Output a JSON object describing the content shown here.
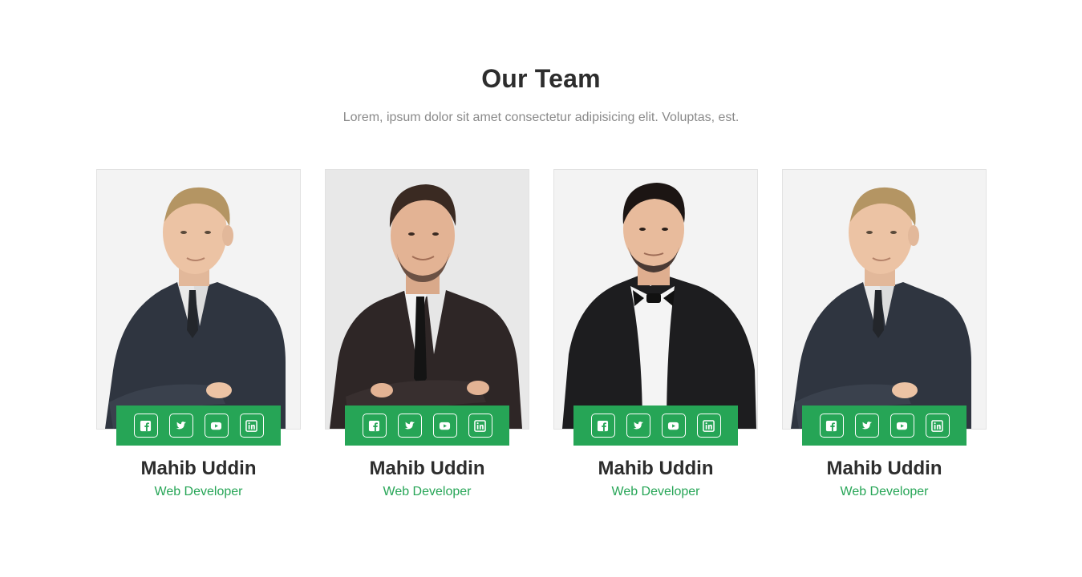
{
  "section": {
    "title": "Our Team",
    "subtitle": "Lorem, ipsum dolor sit amet consectetur adipisicing elit. Voluptas, est."
  },
  "colors": {
    "accent": "#26a556",
    "heading": "#2d2d2d",
    "muted": "#8a8a8a"
  },
  "members": [
    {
      "name": "Mahib Uddin",
      "role": "Web Developer",
      "photo": "man-blond-dark-suit"
    },
    {
      "name": "Mahib Uddin",
      "role": "Web Developer",
      "photo": "man-brown-hair-suit"
    },
    {
      "name": "Mahib Uddin",
      "role": "Web Developer",
      "photo": "man-black-hair-bowtie"
    },
    {
      "name": "Mahib Uddin",
      "role": "Web Developer",
      "photo": "man-blond-dark-suit"
    }
  ],
  "social_icons": [
    "facebook-icon",
    "twitter-icon",
    "youtube-icon",
    "linkedin-icon"
  ]
}
